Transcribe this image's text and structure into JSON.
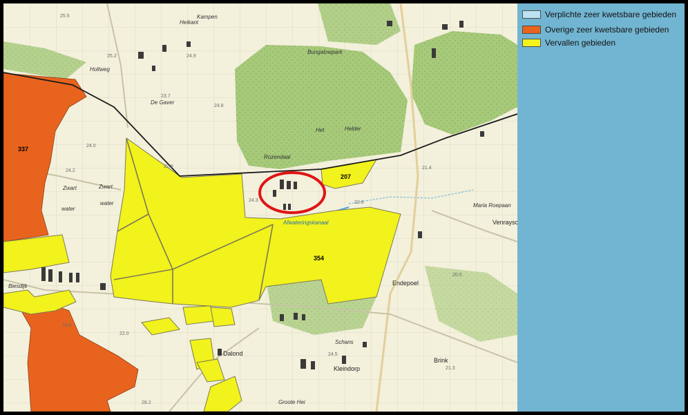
{
  "colors": {
    "background_border": "#000000",
    "map_base": "#f3f0dc",
    "forest": "#a6c97a",
    "legend_panel": "#72b5d2",
    "verplichte": "#bde3f3",
    "overige": "#e8641e",
    "vervallen": "#f2f21c",
    "highlight_circle": "#e01414",
    "boundary_line": "#1a1a1a"
  },
  "legend": {
    "items": [
      {
        "label": "Verplichte zeer kwetsbare gebieden",
        "color": "#bde3f3"
      },
      {
        "label": "Overige zeer kwetsbare gebieden",
        "color": "#e8641e"
      },
      {
        "label": "Vervallen gebieden",
        "color": "#f2f21c"
      }
    ]
  },
  "area_labels": {
    "area_337": "337",
    "area_354": "354",
    "area_207": "207"
  },
  "place_names": {
    "de_gaver": "De Gaver",
    "zwart_water_1": "Zwart",
    "zwart_water_2": "water",
    "zwart_water_3": "Zwart",
    "zwart_water_4": "water",
    "rozendaal": "Rozendaal",
    "het_helder_1": "Het",
    "het_helder_2": "Helder",
    "endepoel": "Endepoel",
    "dalond": "Dalond",
    "kleindorp": "Kleindorp",
    "brink": "Brink",
    "venraysche": "Venraysche",
    "maria_roepaan": "Maria Roepaan",
    "groote_hei": "Groote Hei",
    "biesdijk": "Biesdijk",
    "rotterdam_dijk": "Afwateringskanaal",
    "bungalowpark": "Bungalowpark",
    "holtweg": "Holtweg",
    "kampen": "Kampen",
    "heikant": "Heikant",
    "schans": "Schans"
  },
  "elevations": [
    "25.5",
    "24.8",
    "24.2",
    "24.9",
    "22.6",
    "24.0",
    "24.3",
    "22.0",
    "23.7",
    "21.4",
    "25.2",
    "24.5",
    "22.9",
    "20.5",
    "23.8",
    "21.3",
    "28.2"
  ]
}
